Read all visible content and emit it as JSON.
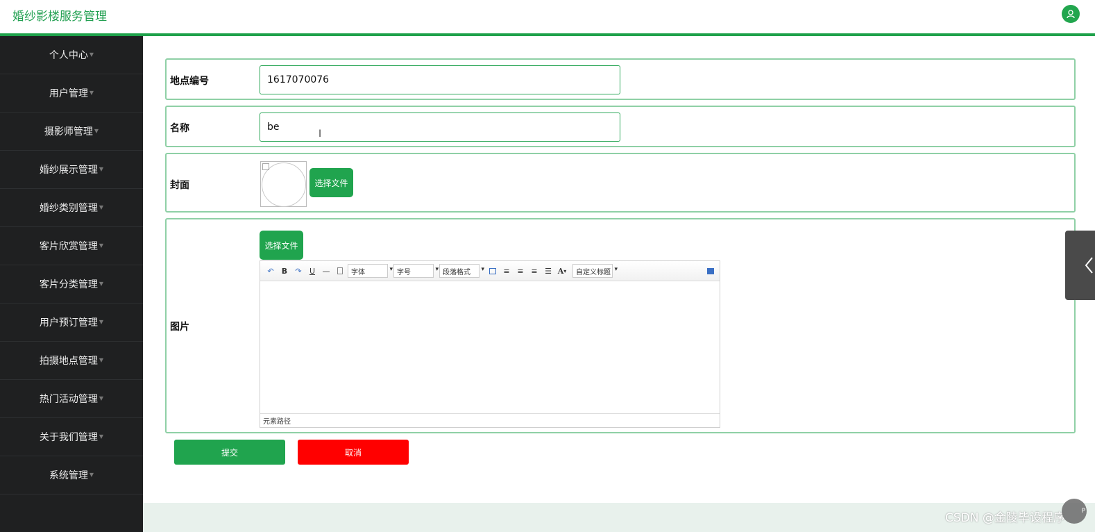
{
  "header": {
    "title": "婚纱影楼服务管理",
    "avatar_icon": "user-icon"
  },
  "sidebar": {
    "items": [
      {
        "label": "个人中心"
      },
      {
        "label": "用户管理"
      },
      {
        "label": "摄影师管理"
      },
      {
        "label": "婚纱展示管理"
      },
      {
        "label": "婚纱类别管理"
      },
      {
        "label": "客片欣赏管理"
      },
      {
        "label": "客片分类管理"
      },
      {
        "label": "用户预订管理"
      },
      {
        "label": "拍摄地点管理"
      },
      {
        "label": "热门活动管理"
      },
      {
        "label": "关于我们管理"
      },
      {
        "label": "系统管理"
      }
    ]
  },
  "form": {
    "code_label": "地点编号",
    "code_value": "1617070076",
    "name_label": "名称",
    "name_value": "be",
    "cover_label": "封面",
    "cover_button": "选择文件",
    "image_label": "图片",
    "image_button": "选择文件",
    "editor": {
      "font_select": "字体",
      "size_select": "字号",
      "para_select": "段落格式",
      "custom_select": "自定义标题",
      "status_path": "元素路径"
    },
    "submit_label": "提交",
    "cancel_label": "取消"
  },
  "watermark": "CSDN @金陵毕设程序",
  "corner_badge": "P",
  "colors": {
    "primary": "#20a44e",
    "danger": "#ff0000",
    "sidebar_bg": "#1f2021"
  }
}
